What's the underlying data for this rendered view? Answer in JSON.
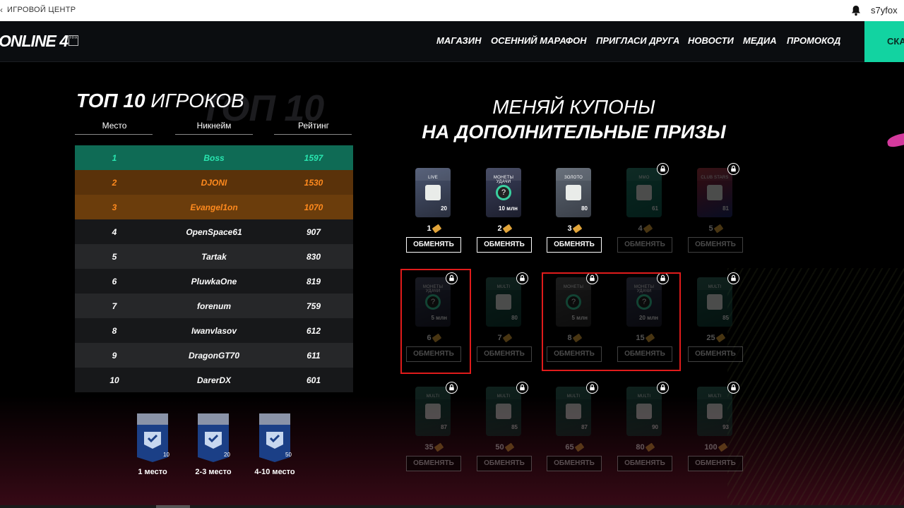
{
  "topbar": {
    "title": "ИГРОВОЙ ЦЕНТР",
    "username": "s7yfox"
  },
  "nav": {
    "logo": "ONLINE 4",
    "logo_badge": "FIFA",
    "items": [
      "МАГАЗИН",
      "ОСЕННИЙ МАРАФОН",
      "ПРИГЛАСИ ДРУГА",
      "НОВОСТИ",
      "МЕДИА",
      "ПРОМОКОД"
    ],
    "cta": "СКА"
  },
  "leaderboard": {
    "watermark": "ТОП 10",
    "title_bold": "ТОП 10",
    "title_rest": "ИГРОКОВ",
    "headers": [
      "Место",
      "Никнейм",
      "Рейтинг"
    ],
    "rows": [
      {
        "place": "1",
        "name": "Boss",
        "rating": "1597"
      },
      {
        "place": "2",
        "name": "DJONI",
        "rating": "1530"
      },
      {
        "place": "3",
        "name": "Evangel1on",
        "rating": "1070"
      },
      {
        "place": "4",
        "name": "OpenSpace61",
        "rating": "907"
      },
      {
        "place": "5",
        "name": "Tartak",
        "rating": "830"
      },
      {
        "place": "6",
        "name": "PluwkaOne",
        "rating": "819"
      },
      {
        "place": "7",
        "name": "forenum",
        "rating": "759"
      },
      {
        "place": "8",
        "name": "Iwanvlasov",
        "rating": "612"
      },
      {
        "place": "9",
        "name": "DragonGT70",
        "rating": "611"
      },
      {
        "place": "10",
        "name": "DarerDX",
        "rating": "601"
      }
    ],
    "prizes": [
      {
        "label": "1 место",
        "card_num": "10"
      },
      {
        "label": "2-3 место",
        "card_num": "20"
      },
      {
        "label": "4-10 место",
        "card_num": "50"
      }
    ]
  },
  "coupons": {
    "title_line1": "МЕНЯЙ КУПОНЫ",
    "title_line2": "НА ДОПОЛНИТЕЛЬНЫЕ ПРИЗЫ",
    "button_label": "ОБМЕНЯТЬ",
    "rewards": [
      {
        "cost": "1",
        "card_title": "LIVE",
        "card_num": "20",
        "locked": false
      },
      {
        "cost": "2",
        "card_title": "МОНЕТЫ УДАЧИ",
        "card_num": "10 млн",
        "locked": false
      },
      {
        "cost": "3",
        "card_title": "ЗОЛОТО",
        "card_num": "80",
        "locked": false
      },
      {
        "cost": "4",
        "card_title": "MMO",
        "card_num": "61",
        "locked": true
      },
      {
        "cost": "5",
        "card_title": "CLUB STARS",
        "card_num": "81",
        "locked": true
      },
      {
        "cost": "6",
        "card_title": "МОНЕТЫ УДАЧИ",
        "card_num": "5 млн",
        "locked": true
      },
      {
        "cost": "7",
        "card_title": "MULTI",
        "card_num": "80",
        "locked": true
      },
      {
        "cost": "8",
        "card_title": "МОНЕТЫ",
        "card_num": "5 млн",
        "locked": true
      },
      {
        "cost": "15",
        "card_title": "МОНЕТЫ УДАЧИ",
        "card_num": "20 млн",
        "locked": true
      },
      {
        "cost": "25",
        "card_title": "MULTI",
        "card_num": "85",
        "locked": true
      },
      {
        "cost": "35",
        "card_title": "MULTI",
        "card_num": "87",
        "locked": true
      },
      {
        "cost": "50",
        "card_title": "MULTI",
        "card_num": "85",
        "locked": true
      },
      {
        "cost": "65",
        "card_title": "MULTI",
        "card_num": "87",
        "locked": true
      },
      {
        "cost": "80",
        "card_title": "MULTI",
        "card_num": "90",
        "locked": true
      },
      {
        "cost": "100",
        "card_title": "MULTI",
        "card_num": "93",
        "locked": true
      }
    ]
  },
  "colors": {
    "accent": "#12d3a1",
    "first_place_bg": "#0f6b55",
    "second_third_bg": "#5a320a",
    "highlight": "#e01b1b"
  }
}
